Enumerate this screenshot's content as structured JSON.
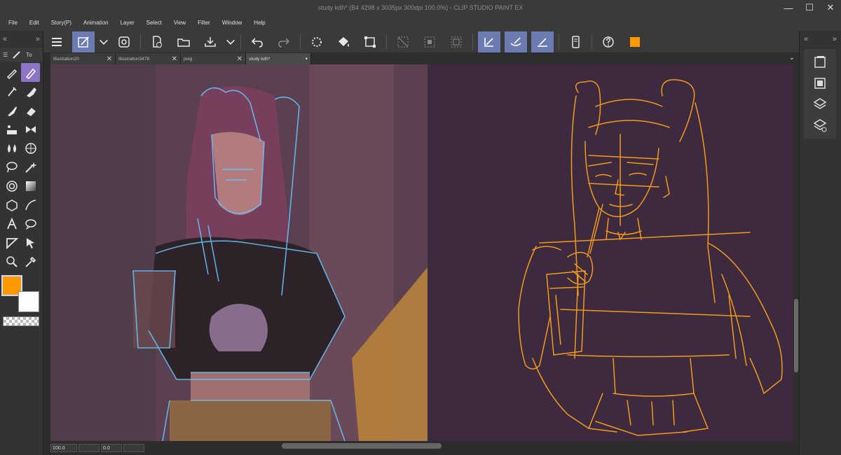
{
  "app": {
    "title": "study kdh* (B4 4298 x 3035px 300dpi 100.0%) - CLIP STUDIO PAINT EX",
    "controls": {
      "minimize": "—",
      "maximize": "☐",
      "close": "✕"
    }
  },
  "menu": [
    "File",
    "Edit",
    "Story(P)",
    "Animation",
    "Layer",
    "Select",
    "View",
    "Filter",
    "Window",
    "Help"
  ],
  "left_panel": {
    "collapse": "«",
    "expand": "»",
    "tab_label": "To"
  },
  "tabs": [
    {
      "label": "Illustration20",
      "close": "✕"
    },
    {
      "label": "Illustration3478",
      "close": "✕"
    },
    {
      "label": "poig",
      "close": "✕"
    },
    {
      "label": "study kdh*",
      "close": "•"
    }
  ],
  "tab_dropdown": "⌄",
  "right_panel": {
    "collapse": "«",
    "expand": "»"
  },
  "colors": {
    "main": "#ff9900",
    "sub": "#ffffff",
    "accent": "#6c7bb1",
    "active_tool": "#8e74c6",
    "sketch": "#f29a1a",
    "lineart_blue": "#66c7ff",
    "canvas_right_bg": "#3e2a3f"
  },
  "status": {
    "zoom": "100.0",
    "rotation": "0.0"
  }
}
